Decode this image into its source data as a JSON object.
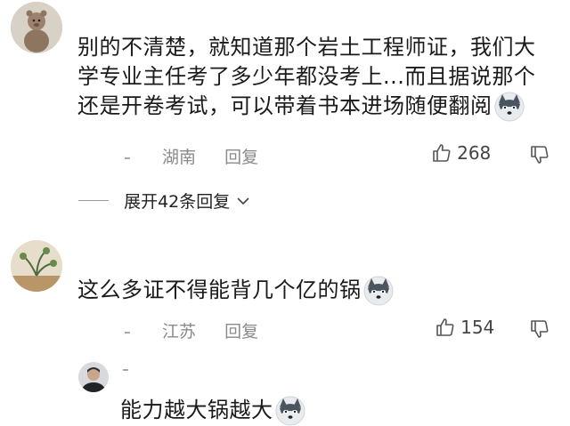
{
  "comments": [
    {
      "text_line1": "别的不清楚，就知道那个岩土工程师证，我们大",
      "text_line2": "学专业主任考了多少年都没考上...而且据说那个",
      "text_line3": "还是开卷考试，可以带着书本进场随便翻阅",
      "location": "湖南",
      "reply_label": "回复",
      "likes": "268",
      "expand_label": "展开42条回复"
    },
    {
      "text_line1": "这么多证不得能背几个亿的锅",
      "location": "江苏",
      "reply_label": "回复",
      "likes": "154"
    },
    {
      "text_line1": "能力越大锅越大"
    }
  ],
  "colors": {
    "meta": "#8a8a8a",
    "divider": "#9a9a9a",
    "text": "#1a1a1a"
  }
}
